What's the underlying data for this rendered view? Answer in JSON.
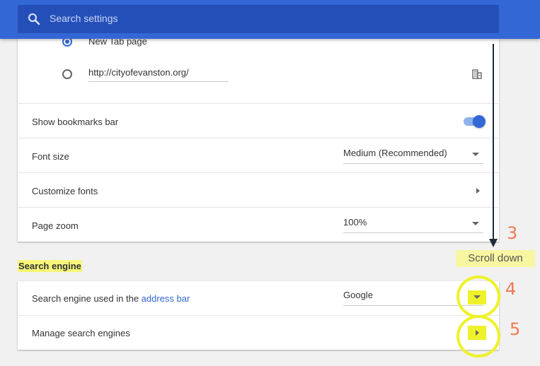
{
  "header": {
    "search_placeholder": "Search settings"
  },
  "startup": {
    "option_new_tab": "New Tab page",
    "custom_url": "http://cityofevanston.org/"
  },
  "appearance": {
    "bookmarks_label": "Show bookmarks bar",
    "bookmarks_on": true,
    "font_size_label": "Font size",
    "font_size_value": "Medium (Recommended)",
    "customize_fonts_label": "Customize fonts",
    "page_zoom_label": "Page zoom",
    "page_zoom_value": "100%"
  },
  "search_engine": {
    "section_title": "Search engine",
    "used_label_prefix": "Search engine used in the ",
    "used_label_link": "address bar",
    "engine_value": "Google",
    "manage_label": "Manage search engines"
  },
  "annotations": {
    "step3": "3",
    "scroll_note": "Scroll down",
    "step4": "4",
    "step5": "5",
    "highlight_color": "#eef22a",
    "step_color": "#f07a52"
  },
  "colors": {
    "accent": "#3367d6",
    "header": "#3367d6"
  }
}
